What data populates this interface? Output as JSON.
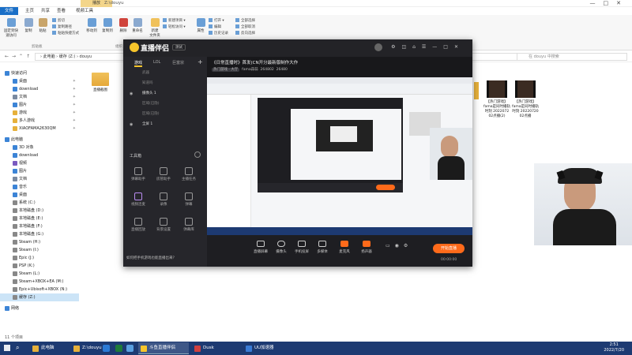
{
  "explorer": {
    "title": "Z:\\douyu",
    "context_tab": "播放",
    "tabs": [
      "文件",
      "主页",
      "共享",
      "查看",
      "视频工具"
    ],
    "ribbon": {
      "pin": "固定到快\n速访问",
      "copy": "复制",
      "paste": "粘贴",
      "cut": "剪切",
      "copy_path": "复制路径",
      "paste_shortcut": "粘贴快捷方式",
      "move_to": "移动到",
      "copy_to": "复制到",
      "delete": "删除",
      "rename": "重命名",
      "new_folder": "新建\n文件夹",
      "new_item": "新建项目 ▾",
      "easy_access": "轻松访问 ▾",
      "properties": "属性",
      "open": "打开 ▾",
      "edit": "编辑",
      "history": "历史记录",
      "select_all": "全部选择",
      "select_none": "全部取消",
      "invert": "反向选择",
      "group_clipboard": "剪贴板",
      "group_organize": "组织",
      "group_new": "新建",
      "group_open": "打开",
      "group_select": "选择"
    },
    "address": {
      "path": "› 此电脑 › 缓存 (Z:) › douyu",
      "search_placeholder": "在 douyu 中搜索"
    },
    "nav": [
      {
        "label": "快速访问",
        "color": "#3c84d6"
      },
      {
        "label": "桌面",
        "color": "#3c84d6"
      },
      {
        "label": "download",
        "color": "#3c84d6"
      },
      {
        "label": "文档",
        "color": "#7a8aa0"
      },
      {
        "label": "图片",
        "color": "#3c84d6"
      },
      {
        "label": "游戏",
        "color": "#e6b03a"
      },
      {
        "label": "多人游戏",
        "color": "#e6b03a"
      },
      {
        "label": "XIAOFAMA2630QM",
        "color": "#e6b03a"
      },
      {
        "label": "此电脑",
        "color": "#3c84d6"
      },
      {
        "label": "3D 对象",
        "color": "#3c84d6"
      },
      {
        "label": "download",
        "color": "#3c84d6"
      },
      {
        "label": "视频",
        "color": "#7a5ac0"
      },
      {
        "label": "图片",
        "color": "#3c84d6"
      },
      {
        "label": "文档",
        "color": "#7a8aa0"
      },
      {
        "label": "音乐",
        "color": "#3c84d6"
      },
      {
        "label": "桌面",
        "color": "#3c84d6"
      },
      {
        "label": "系统 (C:)",
        "color": "#888"
      },
      {
        "label": "本地磁盘 (D:)",
        "color": "#888"
      },
      {
        "label": "本地磁盘 (E:)",
        "color": "#888"
      },
      {
        "label": "本地磁盘 (F:)",
        "color": "#888"
      },
      {
        "label": "本地磁盘 (G:)",
        "color": "#888"
      },
      {
        "label": "Steam (H:)",
        "color": "#888"
      },
      {
        "label": "Steam (I:)",
        "color": "#888"
      },
      {
        "label": "Epic (J:)",
        "color": "#888"
      },
      {
        "label": "PSP (K:)",
        "color": "#888"
      },
      {
        "label": "Steam (L:)",
        "color": "#888"
      },
      {
        "label": "Steam+XBOX+EA (M:)",
        "color": "#888"
      },
      {
        "label": "Epic+Ubisoft+XBOX (N:)",
        "color": "#888"
      },
      {
        "label": "缓存 (Z:)",
        "color": "#888"
      },
      {
        "label": "网络",
        "color": "#3c84d6"
      }
    ],
    "files": [
      {
        "name": "直播截图",
        "kind": "folder"
      },
      {
        "name": "【热门游戏】\nfama是同时播轨\n时刻 2022072\n02点播(2)",
        "kind": "video"
      },
      {
        "name": "【热门游戏】\nfama是同时播轨\n时刻 20220720\n02点播",
        "kind": "video"
      }
    ],
    "status": "11 个项目"
  },
  "app": {
    "brand": "直播伴侣",
    "version": "测试",
    "side_tabs": [
      "游戏",
      "LOL",
      "巨富宗"
    ],
    "scenes": [
      {
        "label": "武器",
        "on": false
      },
      {
        "label": "知道吗",
        "on": false
      },
      {
        "label": "摄像头 1",
        "on": true
      },
      {
        "label": "区域(已隐)",
        "on": false
      },
      {
        "label": "区域(已隐)",
        "on": false
      },
      {
        "label": "全屏 1",
        "on": true
      }
    ],
    "toolbox_title": "工具箱",
    "tools": [
      "弹幕助手",
      "房管助手",
      "主播任务",
      "视频连麦",
      "录像",
      "弹幕",
      "直播回放",
      "背景设置",
      "弹幕库"
    ],
    "tip": "如何把手机游戏也能直播出来？",
    "stream_title": "《日常直播时》首发(CN开分最新版制作大作",
    "meta_tag": "热门游戏 · 大厅",
    "meta_user": "fama蒜蒜",
    "meta_count1": "264802",
    "meta_count2": "26480",
    "bottom": [
      "直播屏幕",
      "摄像头",
      "手机投屏",
      "多媒体",
      "麦克风",
      "扬声器"
    ],
    "go_live": "开始直播",
    "timer": "00:00:00"
  },
  "taskbar": {
    "items": [
      {
        "label": "此电脑",
        "color": "#e6b03a",
        "active": false
      },
      {
        "label": "Z:\\douyu",
        "color": "#e6b03a",
        "active": false
      },
      {
        "label": "斗鱼直播伴侣",
        "color": "#f7c52b",
        "active": true
      },
      {
        "label": "Dusk",
        "color": "#d04040",
        "active": false
      },
      {
        "label": "UU加速器",
        "color": "#3a7bd5",
        "active": false
      }
    ],
    "time": "2:51",
    "date": "2022/7/20"
  }
}
